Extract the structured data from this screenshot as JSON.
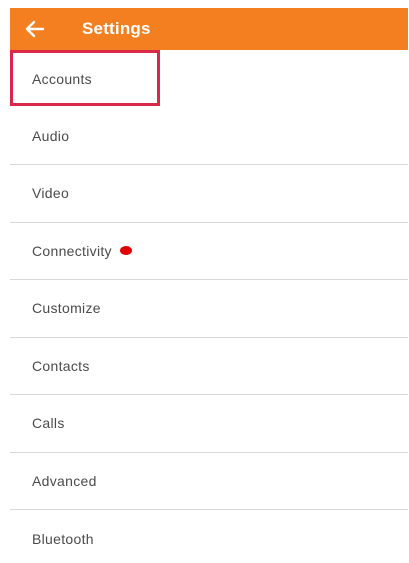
{
  "colors": {
    "app_bar": "#f47f20",
    "highlight": "#d9284a",
    "notification_dot": "#e00000"
  },
  "header": {
    "back_icon": "arrow-left-icon",
    "title": "Settings"
  },
  "menu": {
    "items": [
      {
        "label": "Accounts",
        "highlighted": true
      },
      {
        "label": "Audio"
      },
      {
        "label": "Video"
      },
      {
        "label": "Connectivity",
        "has_notification_dot": true
      },
      {
        "label": "Customize"
      },
      {
        "label": "Contacts"
      },
      {
        "label": "Calls"
      },
      {
        "label": "Advanced"
      },
      {
        "label": "Bluetooth"
      }
    ]
  }
}
